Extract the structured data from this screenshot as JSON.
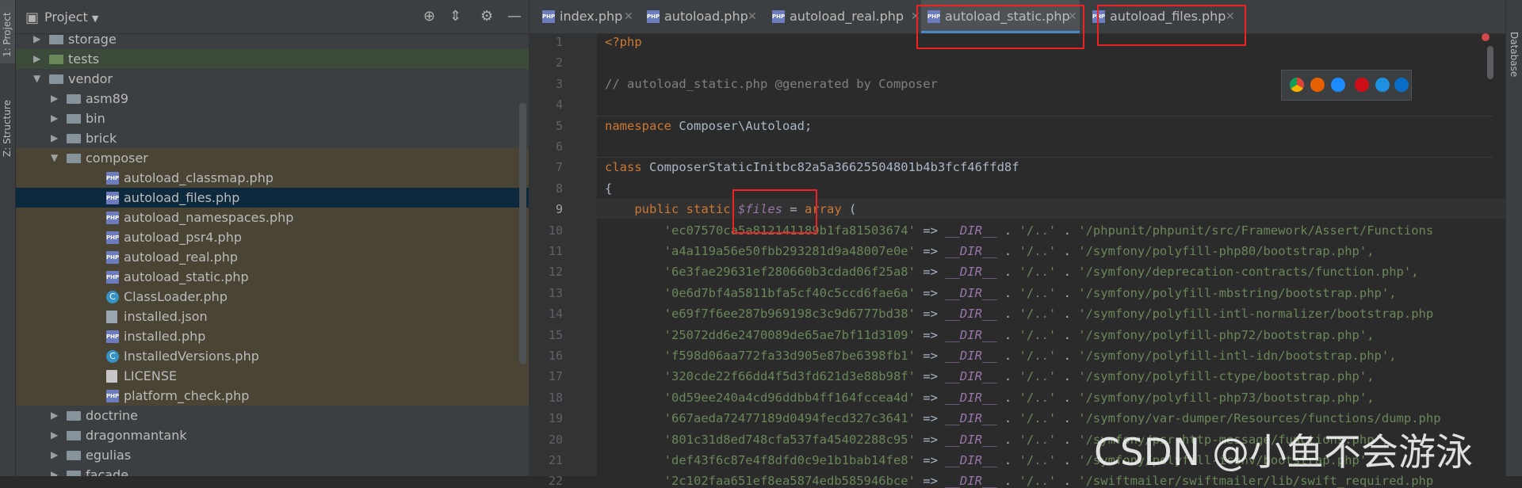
{
  "toolstrip": {
    "project_tab": "1: Project",
    "structure_tab": "Z: Structure"
  },
  "project_panel": {
    "title": "Project",
    "tree": [
      {
        "label": "storage",
        "type": "folder",
        "state": "collapsed",
        "depth": 1
      },
      {
        "label": "tests",
        "type": "folder-green",
        "state": "collapsed",
        "depth": 1
      },
      {
        "label": "vendor",
        "type": "folder",
        "state": "expanded",
        "depth": 1
      },
      {
        "label": "asm89",
        "type": "folder",
        "state": "collapsed",
        "depth": 2
      },
      {
        "label": "bin",
        "type": "folder",
        "state": "collapsed",
        "depth": 2
      },
      {
        "label": "brick",
        "type": "folder",
        "state": "collapsed",
        "depth": 2
      },
      {
        "label": "composer",
        "type": "folder",
        "state": "expanded",
        "depth": 2
      },
      {
        "label": "autoload_classmap.php",
        "type": "php",
        "depth": 3
      },
      {
        "label": "autoload_files.php",
        "type": "php",
        "depth": 3
      },
      {
        "label": "autoload_namespaces.php",
        "type": "php",
        "depth": 3
      },
      {
        "label": "autoload_psr4.php",
        "type": "php",
        "depth": 3
      },
      {
        "label": "autoload_real.php",
        "type": "php",
        "depth": 3
      },
      {
        "label": "autoload_static.php",
        "type": "php",
        "depth": 3
      },
      {
        "label": "ClassLoader.php",
        "type": "class",
        "depth": 3
      },
      {
        "label": "installed.json",
        "type": "json",
        "depth": 3
      },
      {
        "label": "installed.php",
        "type": "php",
        "depth": 3
      },
      {
        "label": "InstalledVersions.php",
        "type": "class",
        "depth": 3
      },
      {
        "label": "LICENSE",
        "type": "text",
        "depth": 3
      },
      {
        "label": "platform_check.php",
        "type": "php",
        "depth": 3
      },
      {
        "label": "doctrine",
        "type": "folder",
        "state": "collapsed",
        "depth": 2
      },
      {
        "label": "dragonmantank",
        "type": "folder",
        "state": "collapsed",
        "depth": 2
      },
      {
        "label": "egulias",
        "type": "folder",
        "state": "collapsed",
        "depth": 2
      },
      {
        "label": "facade",
        "type": "folder",
        "state": "collapsed",
        "depth": 2
      }
    ],
    "selected": "autoload_files.php"
  },
  "tabs": [
    {
      "label": "index.php",
      "active": false
    },
    {
      "label": "autoload.php",
      "active": false
    },
    {
      "label": "autoload_real.php",
      "active": false
    },
    {
      "label": "autoload_static.php",
      "active": true
    },
    {
      "label": "autoload_files.php",
      "active": false
    }
  ],
  "editor": {
    "current_line": 9,
    "line_numbers": [
      "1",
      "2",
      "3",
      "4",
      "5",
      "6",
      "7",
      "8",
      "9",
      "10",
      "11",
      "12",
      "13",
      "14",
      "15",
      "16",
      "17",
      "18",
      "19",
      "20",
      "21",
      "22"
    ],
    "lines": {
      "l1": "<?php",
      "l3": "// autoload_static.php @generated by Composer",
      "l5_kw": "namespace",
      "l5_rest": " Composer\\Autoload;",
      "l7_kw": "class",
      "l7_rest": " ComposerStaticInitbc82a5a36625504801b4b3fcf46ffd8f",
      "l8": "{",
      "l9_kw": "public static",
      "l9_var": "$files",
      "l9_eq": " = ",
      "l9_arr": "array",
      "l9_paren": " ("
    },
    "files_array": [
      {
        "hash": "'ec07570ca5a812141189b1fa81503674'",
        "path": "'/phpunit/phpunit/src/Framework/Assert/Functions"
      },
      {
        "hash": "'a4a119a56e50fbb293281d9a48007e0e'",
        "path": "'/symfony/polyfill-php80/bootstrap.php',"
      },
      {
        "hash": "'6e3fae29631ef280660b3cdad06f25a8'",
        "path": "'/symfony/deprecation-contracts/function.php',"
      },
      {
        "hash": "'0e6d7bf4a5811bfa5cf40c5ccd6fae6a'",
        "path": "'/symfony/polyfill-mbstring/bootstrap.php',"
      },
      {
        "hash": "'e69f7f6ee287b969198c3c9d6777bd38'",
        "path": "'/symfony/polyfill-intl-normalizer/bootstrap.php"
      },
      {
        "hash": "'25072dd6e2470089de65ae7bf11d3109'",
        "path": "'/symfony/polyfill-php72/bootstrap.php',"
      },
      {
        "hash": "'f598d06aa772fa33d905e87be6398fb1'",
        "path": "'/symfony/polyfill-intl-idn/bootstrap.php',"
      },
      {
        "hash": "'320cde22f66dd4f5d3fd621d3e88b98f'",
        "path": "'/symfony/polyfill-ctype/bootstrap.php',"
      },
      {
        "hash": "'0d59ee240a4cd96ddbb4ff164fccea4d'",
        "path": "'/symfony/polyfill-php73/bootstrap.php',"
      },
      {
        "hash": "'667aeda72477189d0494fecd327c3641'",
        "path": "'/symfony/var-dumper/Resources/functions/dump.php"
      },
      {
        "hash": "'801c31d8ed748cfa537fa45402288c95'",
        "path": "'/symfony/psr-http-message/functions.php',"
      },
      {
        "hash": "'def43f6c87e4f8dfd0c9e1b1bab14fe8'",
        "path": "'/symfony/polyfill-iconv/bootstrap.php',"
      },
      {
        "hash": "'2c102faa651ef8ea5874edb585946bce'",
        "path": "'/swiftmailer/swiftmailer/lib/swift_required.php"
      }
    ],
    "dir_const": "__DIR__",
    "arrow": " => ",
    "concat1": " . ",
    "dotdot": "'/..'",
    "concat2": " . "
  },
  "right_strip": {
    "database_tab": "Database"
  },
  "watermark": "CSDN @小鱼不会游泳",
  "colors": {
    "keyword": "#cc7832",
    "string": "#6a8759",
    "comment": "#808080",
    "constant": "#9876aa",
    "highlight_box": "#e22222"
  }
}
